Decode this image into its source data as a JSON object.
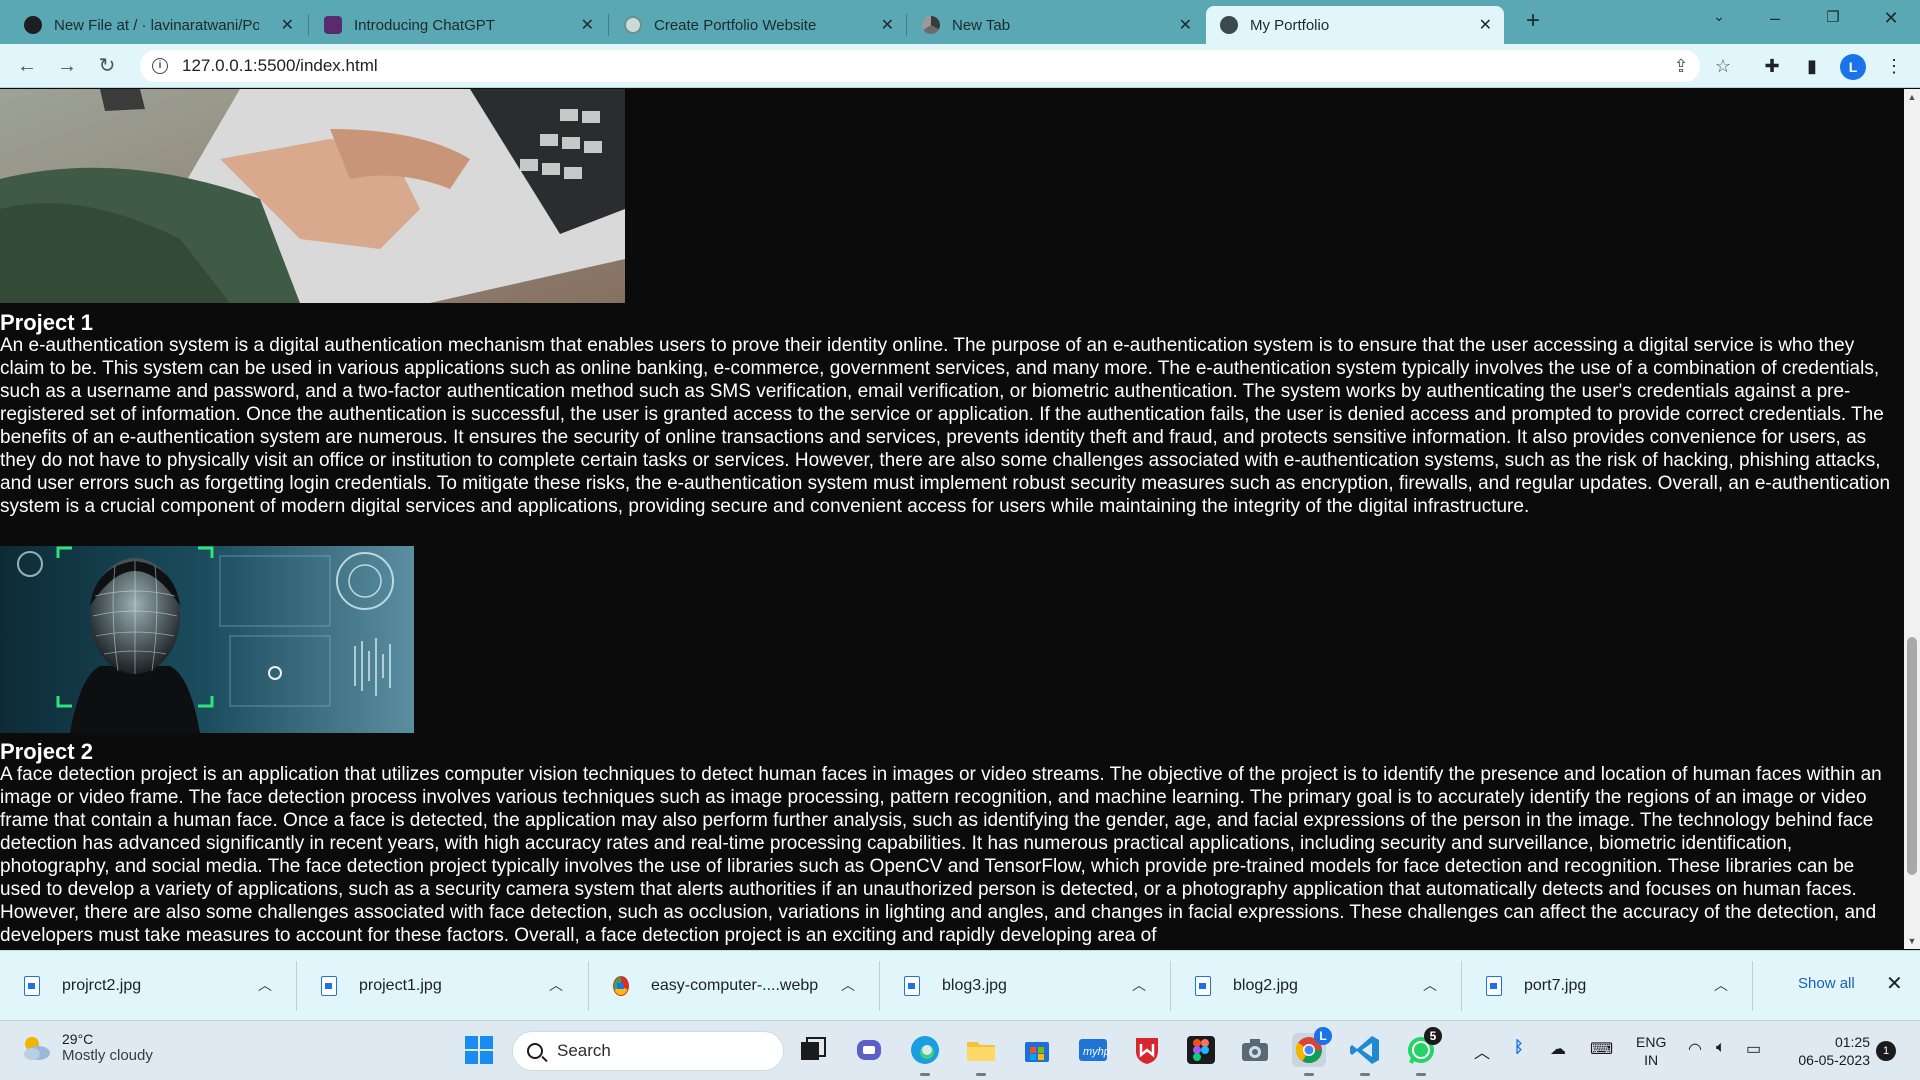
{
  "browser": {
    "tabs": [
      {
        "title": "New File at / · lavinaratwani/Portf",
        "icon": "github-icon"
      },
      {
        "title": "Introducing ChatGPT",
        "icon": "chatgpt-icon"
      },
      {
        "title": "Create Portfolio Website",
        "icon": "chatgpt-icon"
      },
      {
        "title": "New Tab",
        "icon": "chrome-icon"
      },
      {
        "title": "My Portfolio",
        "icon": "globe-icon",
        "active": true
      }
    ],
    "url": "127.0.0.1:5500/index.html",
    "profile_initial": "L"
  },
  "page": {
    "projects": [
      {
        "title": "Project 1",
        "text": "An e-authentication system is a digital authentication mechanism that enables users to prove their identity online. The purpose of an e-authentication system is to ensure that the user accessing a digital service is who they claim to be. This system can be used in various applications such as online banking, e-commerce, government services, and many more. The e-authentication system typically involves the use of a combination of credentials, such as a username and password, and a two-factor authentication method such as SMS verification, email verification, or biometric authentication. The system works by authenticating the user's credentials against a pre-registered set of information. Once the authentication is successful, the user is granted access to the service or application. If the authentication fails, the user is denied access and prompted to provide correct credentials. The benefits of an e-authentication system are numerous. It ensures the security of online transactions and services, prevents identity theft and fraud, and protects sensitive information. It also provides convenience for users, as they do not have to physically visit an office or institution to complete certain tasks or services. However, there are also some challenges associated with e-authentication systems, such as the risk of hacking, phishing attacks, and user errors such as forgetting login credentials. To mitigate these risks, the e-authentication system must implement robust security measures such as encryption, firewalls, and regular updates. Overall, an e-authentication system is a crucial component of modern digital services and applications, providing secure and convenient access for users while maintaining the integrity of the digital infrastructure."
      },
      {
        "title": "Project 2",
        "text": "A face detection project is an application that utilizes computer vision techniques to detect human faces in images or video streams. The objective of the project is to identify the presence and location of human faces within an image or video frame. The face detection process involves various techniques such as image processing, pattern recognition, and machine learning. The primary goal is to accurately identify the regions of an image or video frame that contain a human face. Once a face is detected, the application may also perform further analysis, such as identifying the gender, age, and facial expressions of the person in the image. The technology behind face detection has advanced significantly in recent years, with high accuracy rates and real-time processing capabilities. It has numerous practical applications, including security and surveillance, biometric identification, photography, and social media. The face detection project typically involves the use of libraries such as OpenCV and TensorFlow, which provide pre-trained models for face detection and recognition. These libraries can be used to develop a variety of applications, such as a security camera system that alerts authorities if an unauthorized person is detected, or a photography application that automatically detects and focuses on human faces. However, there are also some challenges associated with face detection, such as occlusion, variations in lighting and angles, and changes in facial expressions. These challenges can affect the accuracy of the detection, and developers must take measures to account for these factors. Overall, a face detection project is an exciting and rapidly developing area of"
      }
    ]
  },
  "downloads": {
    "items": [
      "projrct2.jpg",
      "project1.jpg",
      "easy-computer-....webp",
      "blog3.jpg",
      "blog2.jpg",
      "port7.jpg"
    ],
    "show_all": "Show all"
  },
  "taskbar": {
    "weather_temp": "29°C",
    "weather_desc": "Mostly cloudy",
    "search_label": "Search",
    "whatsapp_badge": "5",
    "lang_line1": "ENG",
    "lang_line2": "IN",
    "time": "01:25",
    "date": "06-05-2023",
    "notification_count": "1"
  }
}
